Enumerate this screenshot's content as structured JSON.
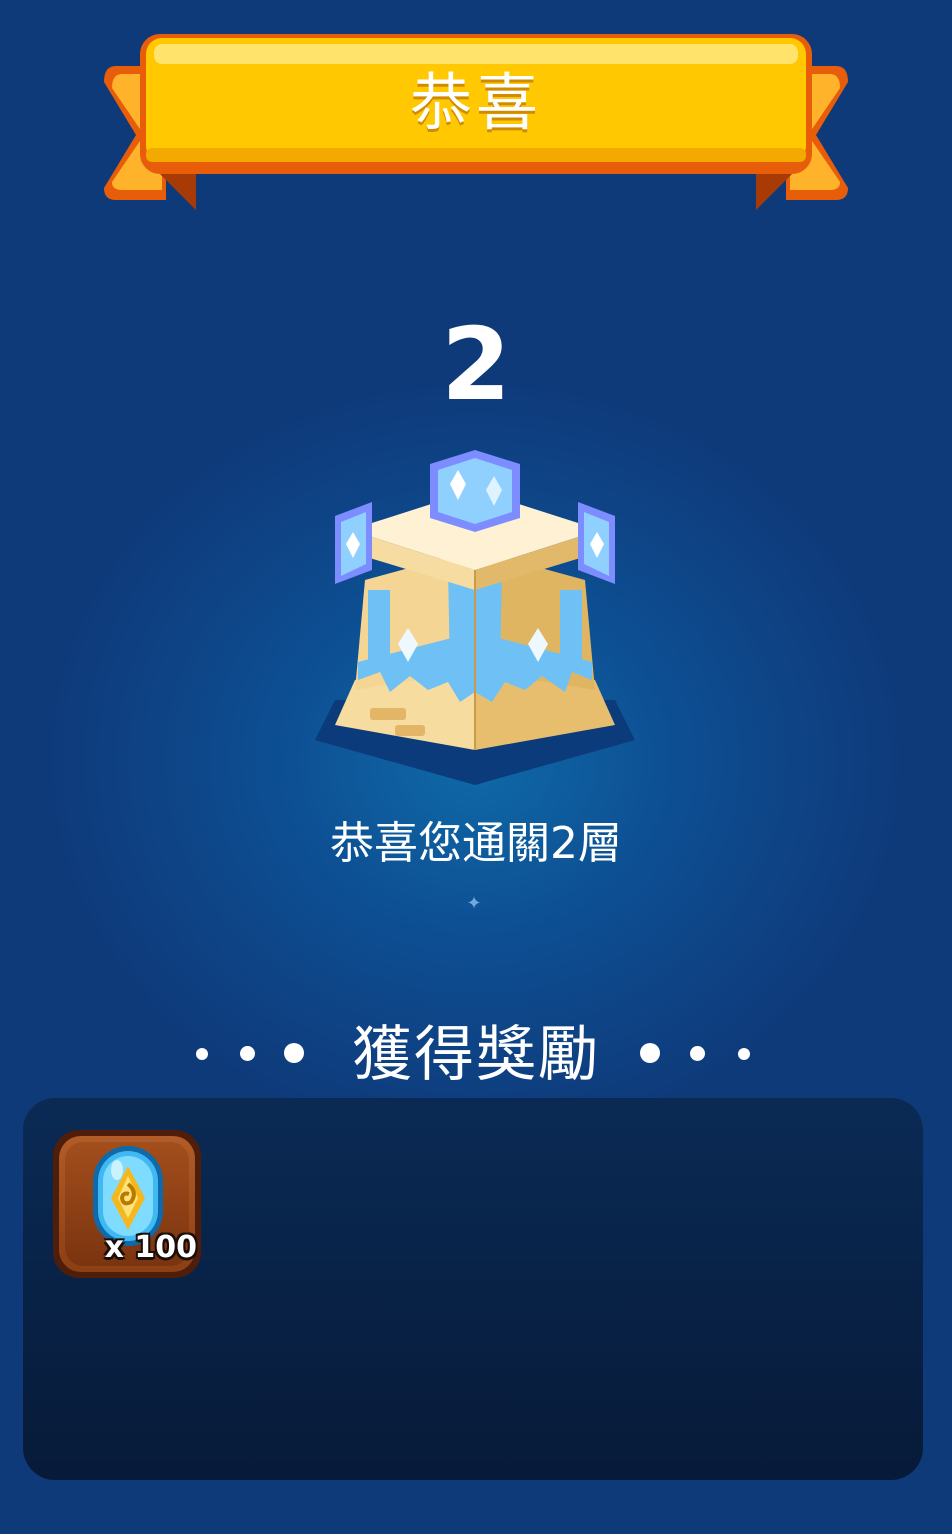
{
  "banner": {
    "title": "恭喜"
  },
  "floor": {
    "number": "2"
  },
  "message": {
    "text": "恭喜您通關2層"
  },
  "rewards": {
    "title": "獲得獎勵",
    "items": [
      {
        "icon": "blue-spiral-gem-icon",
        "count": "x 100"
      }
    ]
  },
  "colors": {
    "background": "#0e3a7a",
    "banner_yellow": "#ffc800",
    "banner_orange": "#ff7a16",
    "panel": "#0a2a55",
    "tower_blue": "#7fa6ff",
    "tower_sand": "#f2d38f"
  }
}
